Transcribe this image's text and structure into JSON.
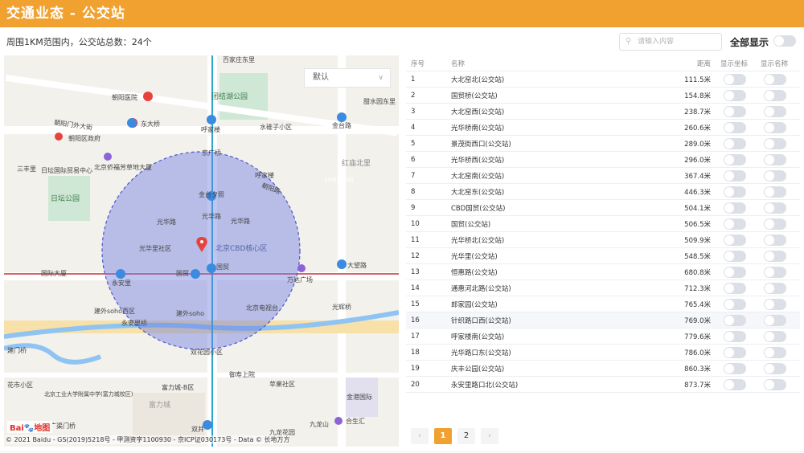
{
  "header": {
    "title": "交通业态 - 公交站"
  },
  "summary": "周围1KM范围内，公交站总数：24个",
  "search": {
    "placeholder": "请输入内容"
  },
  "show_all_label": "全部显示",
  "map": {
    "style_select": "默认",
    "logo_text": "Bai",
    "logo_suffix": "地图",
    "copyright": "© 2021 Baidu - GS(2019)5218号 - 甲测资字1100930 - 京ICP证030173号 - Data © 长地万方",
    "labels": [
      "百家庄东里",
      "朝阳医院",
      "团结湖公园",
      "甜水园东里",
      "朝阳门外大街",
      "东大桥",
      "呼家楼",
      "水碓子小区",
      "金台路",
      "朝阳区政府",
      "京广桥",
      "红庙北里",
      "三丰里",
      "日坛国际贸易中心",
      "北京侨福芳草地大厦",
      "呼家楼",
      "朝阳路",
      "14号线东段",
      "日坛公园",
      "金台夕照",
      "光华路",
      "光华路",
      "光华路",
      "光华里社区",
      "北京CBD核心区",
      "国贸",
      "大望路",
      "国际大厦",
      "永安里",
      "国贸",
      "万达广场",
      "建外soho西区",
      "建外soho",
      "北京电视台",
      "光辉桥",
      "永安里桥",
      "双花园小区",
      "富力城-B区",
      "御寿上院",
      "苹果社区",
      "金港国际",
      "北京工业大学附属中学(富力城校区)",
      "富力城",
      "广渠门桥",
      "双井",
      "九龙山",
      "合生汇",
      "九龙花园",
      "建门桥",
      "花市小区"
    ]
  },
  "table": {
    "columns": [
      "序号",
      "名称",
      "距离",
      "显示坐标",
      "显示名称"
    ],
    "rows": [
      {
        "idx": "1",
        "name": "大北窑北(公交站)",
        "dist": "111.5米"
      },
      {
        "idx": "2",
        "name": "国贸桥(公交站)",
        "dist": "154.8米"
      },
      {
        "idx": "3",
        "name": "大北窑西(公交站)",
        "dist": "238.7米"
      },
      {
        "idx": "4",
        "name": "光华桥南(公交站)",
        "dist": "260.6米"
      },
      {
        "idx": "5",
        "name": "景茂街西口(公交站)",
        "dist": "289.0米"
      },
      {
        "idx": "6",
        "name": "光华桥西(公交站)",
        "dist": "296.0米"
      },
      {
        "idx": "7",
        "name": "大北窑南(公交站)",
        "dist": "367.4米"
      },
      {
        "idx": "8",
        "name": "大北窑东(公交站)",
        "dist": "446.3米"
      },
      {
        "idx": "9",
        "name": "CBD国贸(公交站)",
        "dist": "504.1米"
      },
      {
        "idx": "10",
        "name": "国贸(公交站)",
        "dist": "506.5米"
      },
      {
        "idx": "11",
        "name": "光华桥北(公交站)",
        "dist": "509.9米"
      },
      {
        "idx": "12",
        "name": "光华里(公交站)",
        "dist": "548.5米"
      },
      {
        "idx": "13",
        "name": "恒惠路(公交站)",
        "dist": "680.8米"
      },
      {
        "idx": "14",
        "name": "通惠河北路(公交站)",
        "dist": "712.3米"
      },
      {
        "idx": "15",
        "name": "郎家园(公交站)",
        "dist": "765.4米"
      },
      {
        "idx": "16",
        "name": "针织路口西(公交站)",
        "dist": "769.0米"
      },
      {
        "idx": "17",
        "name": "呼家楼南(公交站)",
        "dist": "779.6米"
      },
      {
        "idx": "18",
        "name": "光华路口东(公交站)",
        "dist": "786.0米"
      },
      {
        "idx": "19",
        "name": "庆丰公园(公交站)",
        "dist": "860.3米"
      },
      {
        "idx": "20",
        "name": "永安里路口北(公交站)",
        "dist": "873.7米"
      }
    ]
  },
  "pagination": {
    "prev": "‹",
    "pages": [
      "1",
      "2"
    ],
    "current": "1",
    "next": "›"
  },
  "colors": {
    "accent": "#f0a12f",
    "circle_fill": "#6e7fe0",
    "circle_stroke": "#4b59c9",
    "marker": "#e8423d"
  }
}
